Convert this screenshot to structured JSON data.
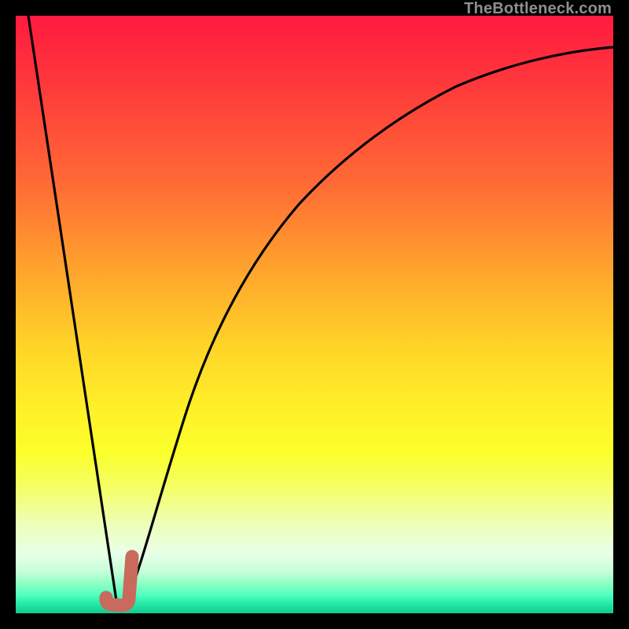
{
  "watermark": "TheBottleneck.com",
  "colors": {
    "frame": "#000000",
    "curve": "#000000",
    "marker": "#c86a5e",
    "grad_top": "#ff1a3f",
    "grad_bottom": "#13c98f"
  },
  "chart_data": {
    "type": "line",
    "title": "",
    "xlabel": "",
    "ylabel": "",
    "xlim": [
      0,
      100
    ],
    "ylim": [
      0,
      100
    ],
    "x": [
      0,
      5,
      10,
      14,
      16,
      18,
      20,
      22,
      25,
      30,
      35,
      40,
      45,
      50,
      55,
      60,
      65,
      70,
      75,
      80,
      85,
      90,
      95,
      100
    ],
    "values": [
      100,
      70,
      40,
      16,
      4,
      0,
      7,
      18,
      32,
      50,
      61,
      69,
      75,
      79,
      82.5,
      85,
      87,
      88.5,
      89.8,
      90.8,
      91.6,
      92.3,
      92.9,
      93.5
    ],
    "annotations": [
      {
        "type": "marker",
        "shape": "J",
        "x": 18.5,
        "y": 2,
        "color": "#c86a5e"
      }
    ]
  }
}
